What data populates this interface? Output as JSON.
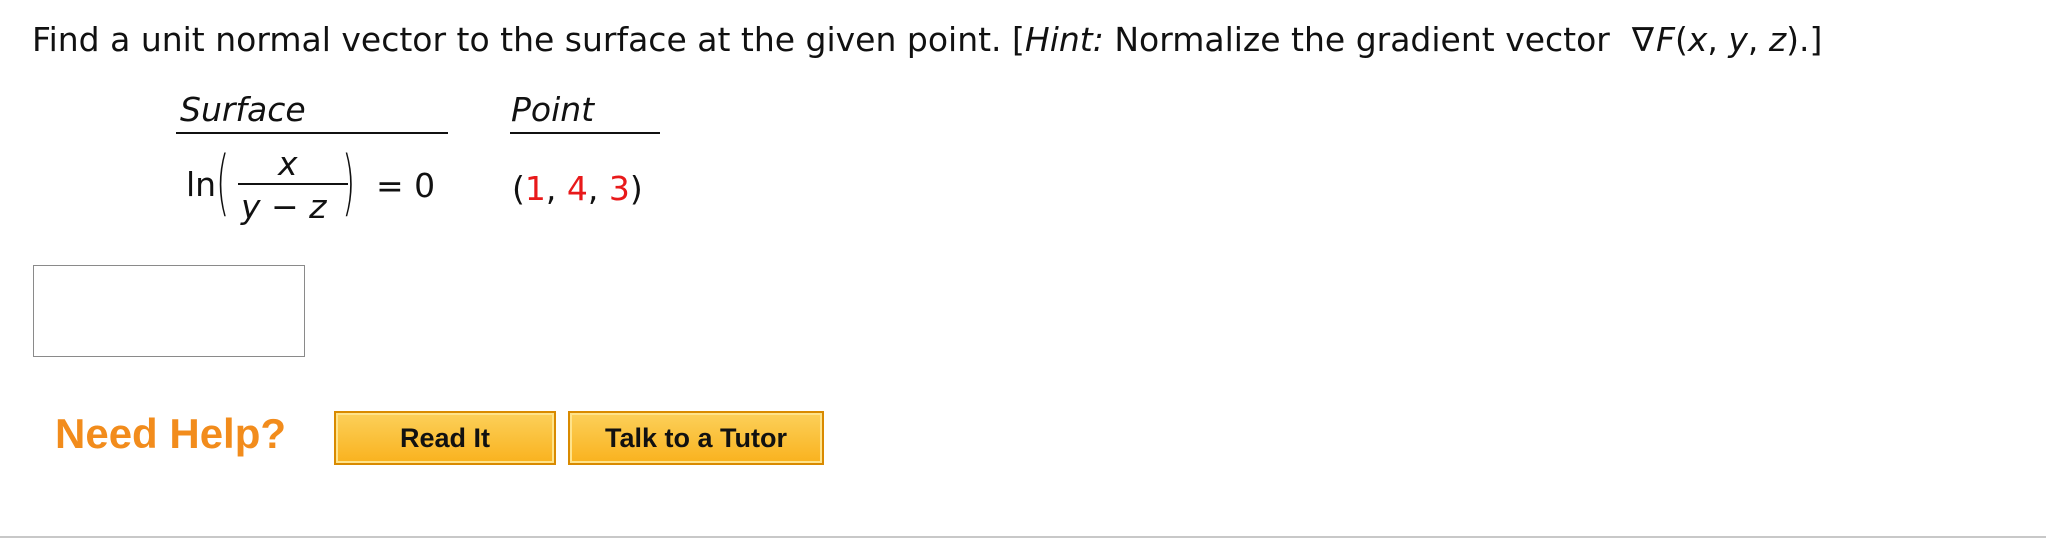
{
  "question": {
    "text": "Find a unit normal vector to the surface at the given point. [",
    "hint_label": "Hint:",
    "hint_text": " Normalize the gradient vector",
    "nabla": "∇",
    "func": "F",
    "args_open": "(",
    "arg_x": "x",
    "sep1": ", ",
    "arg_y": "y",
    "sep2": ", ",
    "arg_z": "z",
    "args_close": ").]"
  },
  "table": {
    "surface_header": "Surface",
    "point_header": "Point",
    "surface": {
      "fn": "ln",
      "open_paren": "(",
      "numerator": "x",
      "denominator_y": "y",
      "minus": " − ",
      "denominator_z": "z",
      "close_paren": ")",
      "rhs": "= 0"
    },
    "point": {
      "open": "(",
      "x": "1",
      "sep1": ", ",
      "y": "4",
      "sep2": ", ",
      "z": "3",
      "close": ")"
    }
  },
  "answer": {
    "value": ""
  },
  "help": {
    "label": "Need Help?",
    "read_it": "Read It",
    "tutor": "Talk to a Tutor"
  },
  "colors": {
    "accent": "#f28c1c",
    "point_values": "#e8191a",
    "button_fill": "#f9b21e"
  }
}
